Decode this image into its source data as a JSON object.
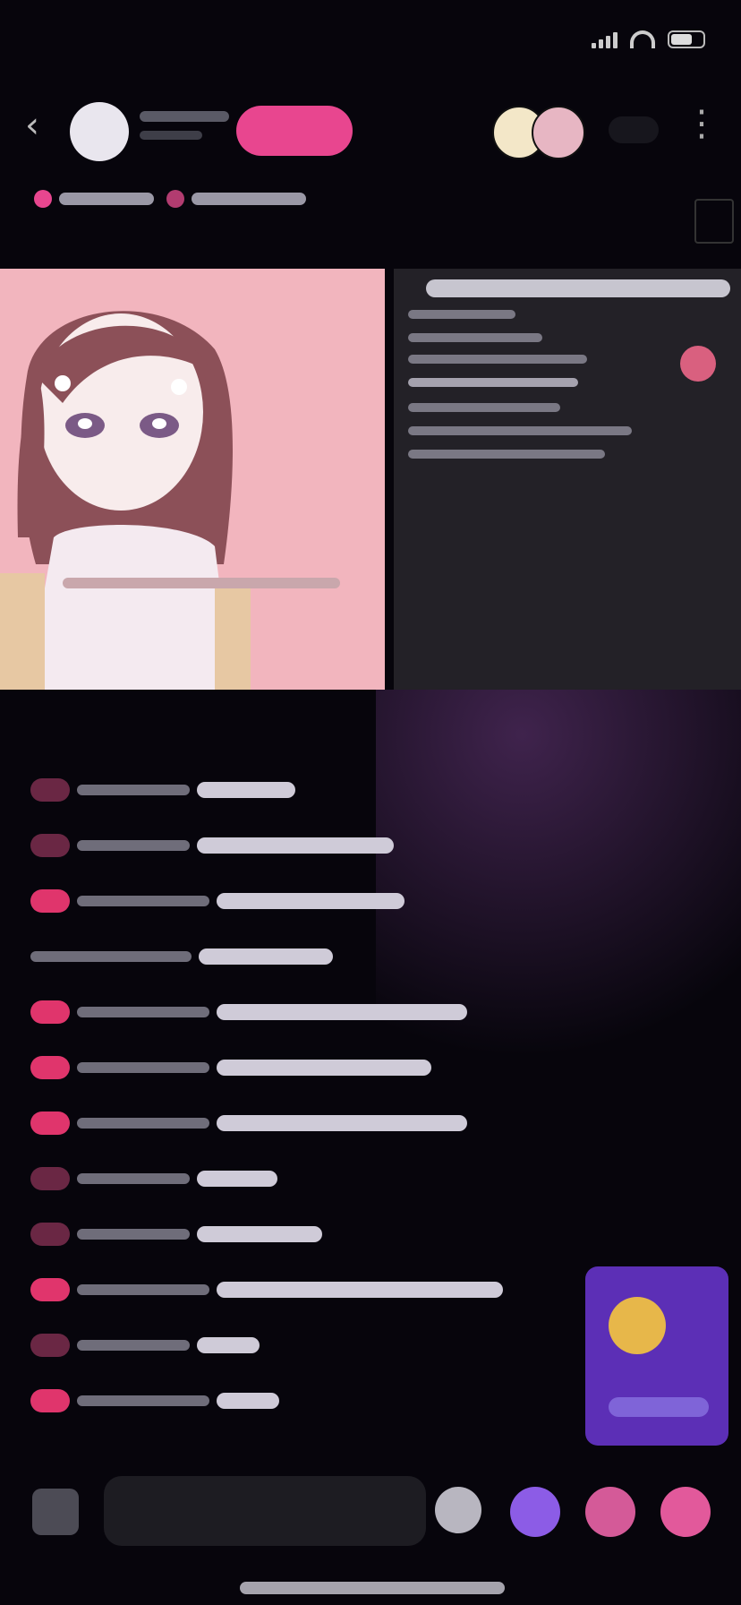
{
  "status_bar": {
    "time": ""
  },
  "header": {
    "follow_label": ""
  },
  "chat": {
    "messages": [
      {
        "level": "dim",
        "name_width": 126,
        "text_width": 110
      },
      {
        "level": "dim",
        "name_width": 126,
        "text_width": 220
      },
      {
        "level": "full",
        "name_width": 148,
        "text_width": 210
      },
      {
        "level": "none",
        "name_width": 180,
        "text_width": 150
      },
      {
        "level": "full",
        "name_width": 148,
        "text_width": 280
      },
      {
        "level": "full",
        "name_width": 148,
        "text_width": 240
      },
      {
        "level": "full",
        "name_width": 148,
        "text_width": 280
      },
      {
        "level": "dim",
        "name_width": 126,
        "text_width": 90
      },
      {
        "level": "dim",
        "name_width": 126,
        "text_width": 140
      },
      {
        "level": "full",
        "name_width": 148,
        "text_width": 320
      },
      {
        "level": "dim",
        "name_width": 126,
        "text_width": 70
      },
      {
        "level": "full",
        "name_width": 148,
        "text_width": 70
      }
    ]
  },
  "input": {
    "placeholder": ""
  },
  "colors": {
    "accent": "#e8468f",
    "gift": "#5c2fb6"
  }
}
